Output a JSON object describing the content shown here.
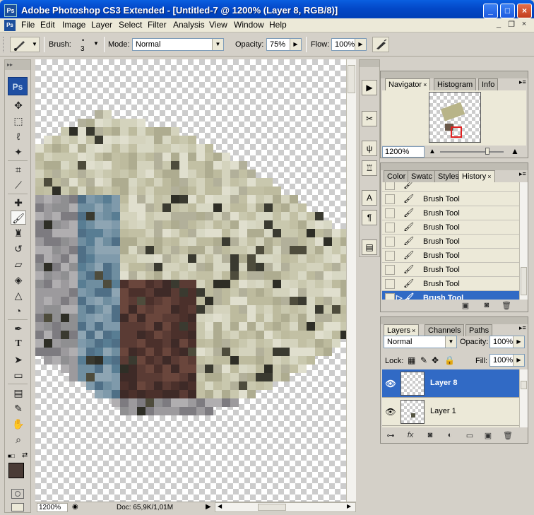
{
  "window": {
    "title": "Adobe Photoshop CS3 Extended - [Untitled-7 @ 1200% (Layer 8, RGB/8)]",
    "logo": "Ps",
    "buttons": {
      "minimize": "_",
      "maximize": "□",
      "close": "×"
    }
  },
  "menu": {
    "items": [
      "File",
      "Edit",
      "Image",
      "Layer",
      "Select",
      "Filter",
      "Analysis",
      "View",
      "Window",
      "Help"
    ],
    "mdi": {
      "minimize": "_",
      "restore": "❐",
      "close": "×"
    }
  },
  "options_bar": {
    "brush_label": "Brush:",
    "brush_size": "3",
    "mode_label": "Mode:",
    "mode_value": "Normal",
    "opacity_label": "Opacity:",
    "opacity_value": "75%",
    "flow_label": "Flow:",
    "flow_value": "100%"
  },
  "tools": {
    "logo": "Ps",
    "items": [
      "move-tool-icon",
      "marquee-tool-icon",
      "lasso-tool-icon",
      "magic-wand-icon",
      "crop-tool-icon",
      "slice-tool-icon",
      "healing-brush-icon",
      "brush-tool-icon",
      "clone-stamp-icon",
      "history-brush-icon",
      "eraser-icon",
      "paint-bucket-icon",
      "blur-tool-icon",
      "dodge-tool-icon",
      "pen-tool-icon",
      "type-tool-icon",
      "path-selection-icon",
      "shape-tool-icon",
      "notes-tool-icon",
      "eyedropper-icon",
      "hand-tool-icon",
      "zoom-tool-icon"
    ],
    "selected": "brush-tool-icon"
  },
  "status_bar": {
    "zoom": "1200%",
    "doc": "Doc: 65,9K/1,01M"
  },
  "navigator": {
    "tabs": [
      "Navigator",
      "Histogram",
      "Info"
    ],
    "zoom": "1200%"
  },
  "history": {
    "tabs": [
      "Color",
      "Swatc",
      "Styles",
      "History"
    ],
    "items": [
      "Brush Tool",
      "Brush Tool",
      "Brush Tool",
      "Brush Tool",
      "Brush Tool",
      "Brush Tool",
      "Brush Tool",
      "Brush Tool"
    ],
    "selected_index": 7
  },
  "layers": {
    "tabs": [
      "Layers",
      "Channels",
      "Paths"
    ],
    "blend_mode": "Normal",
    "opacity_label": "Opacity:",
    "opacity_value": "100%",
    "lock_label": "Lock:",
    "fill_label": "Fill:",
    "fill_value": "100%",
    "items": [
      {
        "name": "Layer 8",
        "selected": true
      },
      {
        "name": "Layer 1",
        "selected": false
      }
    ],
    "footer_icons": [
      "link-icon",
      "fx-icon",
      "mask-icon",
      "adjustment-icon",
      "group-icon",
      "new-layer-icon",
      "trash-icon"
    ]
  }
}
